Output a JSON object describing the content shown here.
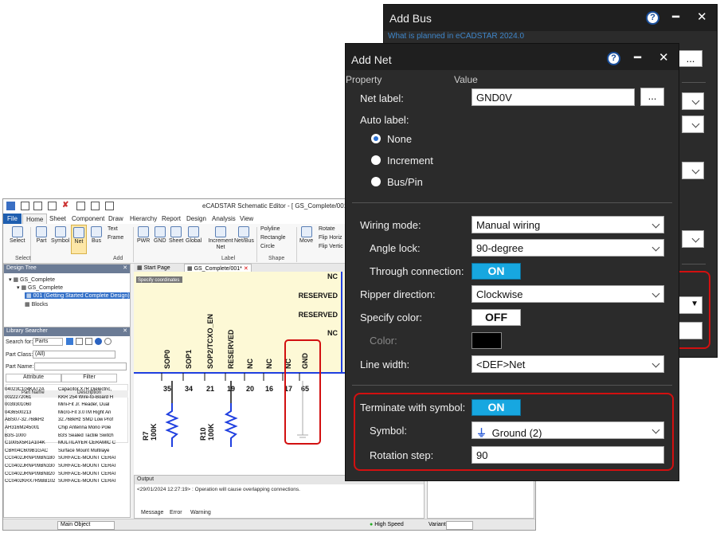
{
  "app": {
    "title": "eCADSTAR Schematic Editor - [ GS_Complete/001* ]",
    "tabs": [
      "File",
      "Home",
      "Sheet",
      "Component",
      "Draw",
      "Hierarchy",
      "Report",
      "Design",
      "Analysis",
      "View"
    ],
    "ribbon": {
      "select": "Select",
      "part": "Part",
      "symbol": "Symbol",
      "net": "Net",
      "bus": "Bus",
      "text": "Text",
      "frame": "Frame",
      "pwr": "PWR",
      "gnd": "GND",
      "sheet": "Sheet",
      "global": "Global",
      "increment_net": "Increment Net",
      "net_bus": "Net/Bus",
      "polyline": "Polyline",
      "rectangle": "Rectangle",
      "circle": "Circle",
      "move": "Move",
      "rotate": "Rotate",
      "flip_horiz": "Flip Horiz",
      "flip_vert": "Flip Vertic",
      "group_select": "Select",
      "group_add": "Add",
      "group_label": "Label",
      "group_shape": "Shape"
    },
    "design_tree": {
      "title": "Design Tree",
      "root": "GS_Complete",
      "child": "GS_Complete",
      "sheet": "001 (Getting Started Complete Design)",
      "blocks": "Blocks"
    },
    "library": {
      "title": "Library Searcher",
      "search_for_label": "Search for:",
      "search_for_value": "Parts",
      "part_class_label": "Part Class:",
      "part_class_value": "(All)",
      "part_name_label": "Part Name:",
      "attribute_tab": "Attribute",
      "filter_tab": "Filter",
      "col_part": "Part Name",
      "col_desc": "Description",
      "rows": [
        [
          "04023C104KAT2A",
          "Capacitor X7R Dielectric,"
        ],
        [
          "0022272061",
          "KKR 254 Wire-to-Board H"
        ],
        [
          "0039301060",
          "Mini-Fit Jr. Header, Dual"
        ],
        [
          "0436500213",
          "Micro-Fit 3.0TM Right An"
        ],
        [
          "ABS07-32.768kHz",
          "32.768kHz SMD Low Prof"
        ],
        [
          "AH316M245001",
          "Chip Antenna Mono Pole"
        ],
        [
          "B3S-1000",
          "B3S Sealed Tactile Switch"
        ],
        [
          "C1005X5R1A104K",
          "MULTILAYER CERAMIC C"
        ],
        [
          "CBR04C609B1GAC",
          "Surface Mount Multilaye"
        ],
        [
          "CC0402JRNP09BN180",
          "SURFACE-MOUNT CERAI"
        ],
        [
          "CC0402JRNP09BN330",
          "SURFACE-MOUNT CERAI"
        ],
        [
          "CC0402JRNP09BN820",
          "SURFACE-MOUNT CERAI"
        ],
        [
          "CC0402KRX7R9BB102",
          "SURFACE-MOUNT CERAI"
        ]
      ]
    },
    "doc_tabs": [
      "Start Page",
      "GS_Complete/001*"
    ],
    "specify_coords": "Specify coordinates",
    "schematic": {
      "right_labels": [
        "NC",
        "RESERVED",
        "RESERVED",
        "NC"
      ],
      "pins": [
        "SOP0",
        "SOP1",
        "SOP2/TCXO_EN",
        "RESERVED",
        "NC",
        "NC",
        "NC",
        "GND"
      ],
      "pin_numbers": [
        "35",
        "34",
        "21",
        "19",
        "20",
        "16",
        "17",
        "65"
      ],
      "r7": "R7",
      "r7_val": "100K",
      "r10": "R10",
      "r10_val": "100K"
    },
    "output": {
      "title": "Output",
      "message": "<29/01/2024 12:27:19> : Operation will cause overlapping connections.",
      "tabs": [
        "Message",
        "Error",
        "Warning"
      ]
    },
    "status": {
      "mode": "Main Object",
      "speed": "High Speed",
      "variant_label": "Variant:"
    }
  },
  "add_bus": {
    "title": "Add Bus",
    "peek_text": "What is planned in eCADSTAR 2024.0",
    "browse": "..."
  },
  "add_net": {
    "title": "Add Net",
    "col_property": "Property",
    "col_value": "Value",
    "net_label": "Net label:",
    "net_label_value": "GND0V",
    "browse": "...",
    "auto_label": "Auto label:",
    "auto_options": [
      "None",
      "Increment",
      "Bus/Pin"
    ],
    "wiring_mode": "Wiring mode:",
    "wiring_mode_value": "Manual wiring",
    "angle_lock": "Angle lock:",
    "angle_lock_value": "90-degree",
    "through_connection": "Through connection:",
    "through_connection_value": "ON",
    "ripper_direction": "Ripper direction:",
    "ripper_direction_value": "Clockwise",
    "specify_color": "Specify color:",
    "specify_color_value": "OFF",
    "color": "Color:",
    "line_width": "Line width:",
    "line_width_value": "<DEF>Net",
    "terminate_with_symbol": "Terminate with symbol:",
    "terminate_value": "ON",
    "symbol": "Symbol:",
    "symbol_value": "Ground (2)",
    "rotation_step": "Rotation step:",
    "rotation_step_value": "90"
  },
  "colors": {
    "accent_on": "#17a7e0",
    "dialog_bg": "#2b2b2b",
    "highlight_red": "#d21010",
    "schematic_bus": "#1f3fe0"
  }
}
